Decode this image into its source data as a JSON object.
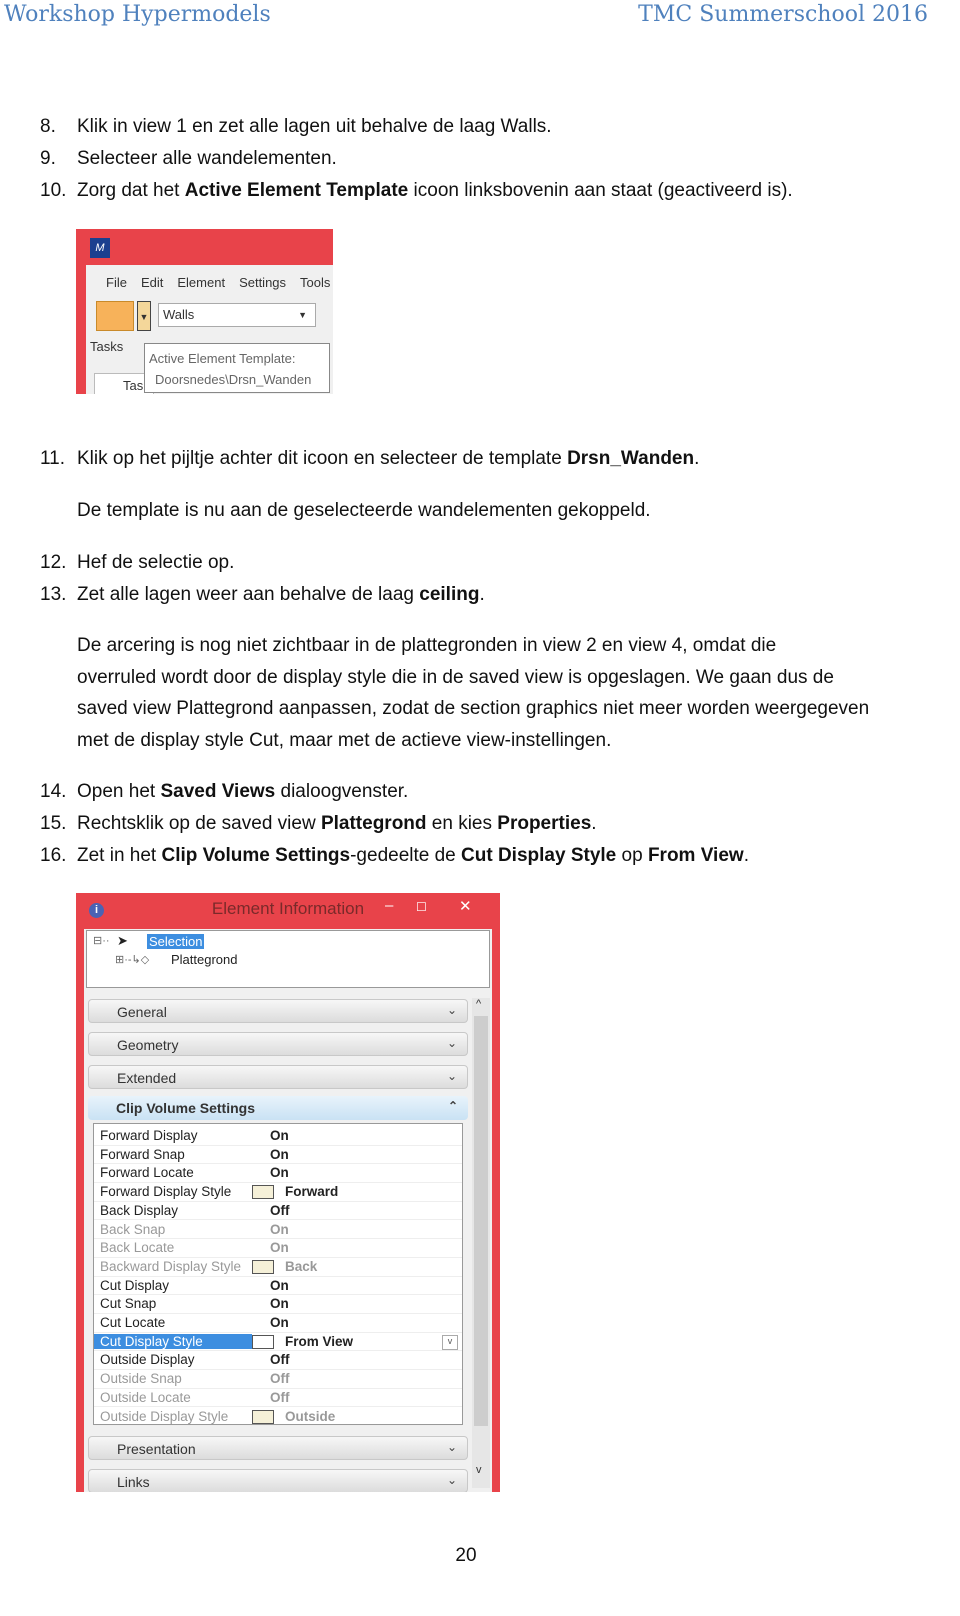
{
  "header": {
    "left": "Workshop Hypermodels",
    "right": "TMC Summerschool 2016"
  },
  "steps_a": [
    {
      "num": "8.",
      "parts": [
        {
          "t": "Klik in view 1 en zet alle lagen uit behalve de laag Walls."
        }
      ]
    },
    {
      "num": "9.",
      "parts": [
        {
          "t": "Selecteer alle wandelementen."
        }
      ]
    },
    {
      "num": "10.",
      "parts": [
        {
          "t": "Zorg dat het "
        },
        {
          "t": "Active Element Template",
          "b": true
        },
        {
          "t": " icoon linksbovenin aan staat (geactiveerd is)."
        }
      ]
    }
  ],
  "shot1": {
    "menu": [
      "File",
      "Edit",
      "Element",
      "Settings",
      "Tools"
    ],
    "combo_value": "Walls",
    "tasks_label": "Tasks",
    "tab_label": "Tas",
    "tooltip_title": "Active Element Template:",
    "tooltip_value": "Doorsnedes\\Drsn_Wanden",
    "accent": "#e8434a"
  },
  "step11": {
    "num": "11.",
    "parts": [
      {
        "t": "Klik op het pijltje achter dit icoon en selecteer de template "
      },
      {
        "t": "Drsn_Wanden",
        "b": true
      },
      {
        "t": "."
      }
    ]
  },
  "note1": "De template is nu aan de geselecteerde wandelementen gekoppeld.",
  "steps_b": [
    {
      "num": "12.",
      "parts": [
        {
          "t": "Hef de selectie op."
        }
      ]
    },
    {
      "num": "13.",
      "parts": [
        {
          "t": "Zet alle lagen weer aan behalve de laag "
        },
        {
          "t": "ceiling",
          "b": true
        },
        {
          "t": "."
        }
      ]
    }
  ],
  "para": [
    "De arcering is nog niet zichtbaar in de plattegronden in view 2 en view 4, omdat die",
    "overruled wordt door de display style die in de saved view is opgeslagen. We gaan dus de",
    "saved view Plattegrond aanpassen, zodat de section graphics niet meer worden weergegeven",
    "met de display style Cut, maar met de actieve view-instellingen."
  ],
  "steps_c": [
    {
      "num": "14.",
      "parts": [
        {
          "t": "Open het "
        },
        {
          "t": "Saved Views",
          "b": true
        },
        {
          "t": " dialoogvenster."
        }
      ]
    },
    {
      "num": "15.",
      "parts": [
        {
          "t": "Rechtsklik op de saved view "
        },
        {
          "t": "Plattegrond",
          "b": true
        },
        {
          "t": " en kies "
        },
        {
          "t": "Properties",
          "b": true
        },
        {
          "t": "."
        }
      ]
    },
    {
      "num": "16.",
      "parts": [
        {
          "t": "Zet in het "
        },
        {
          "t": "Clip Volume Settings",
          "b": true
        },
        {
          "t": "-gedeelte de "
        },
        {
          "t": "Cut Display Style",
          "b": true
        },
        {
          "t": " op "
        },
        {
          "t": "From View",
          "b": true
        },
        {
          "t": "."
        }
      ]
    }
  ],
  "shot2": {
    "title": "Element Information",
    "tree_root": "Selection",
    "tree_child": "Plattegrond",
    "sections_top": [
      "General",
      "Geometry",
      "Extended"
    ],
    "clip_header": "Clip Volume Settings",
    "rows": [
      {
        "k": "Forward Display",
        "v": "On"
      },
      {
        "k": "Forward Snap",
        "v": "On"
      },
      {
        "k": "Forward Locate",
        "v": "On"
      },
      {
        "k": "Forward Display Style",
        "v": "Forward",
        "icon": true
      },
      {
        "k": "Back Display",
        "v": "Off"
      },
      {
        "k": "Back Snap",
        "v": "On",
        "dim": true
      },
      {
        "k": "Back Locate",
        "v": "On",
        "dim": true
      },
      {
        "k": "Backward Display Style",
        "v": "Back",
        "icon": true,
        "dim": true
      },
      {
        "k": "Cut Display",
        "v": "On"
      },
      {
        "k": "Cut Snap",
        "v": "On"
      },
      {
        "k": "Cut Locate",
        "v": "On"
      },
      {
        "k": "Cut Display Style",
        "v": "From View",
        "icon": true,
        "selected": true
      },
      {
        "k": "Outside Display",
        "v": "Off"
      },
      {
        "k": "Outside Snap",
        "v": "Off",
        "dim": true
      },
      {
        "k": "Outside Locate",
        "v": "Off",
        "dim": true
      },
      {
        "k": "Outside Display Style",
        "v": "Outside",
        "icon": true,
        "dim": true
      }
    ],
    "sections_bottom": [
      "Presentation",
      "Links"
    ]
  },
  "page_number": "20"
}
